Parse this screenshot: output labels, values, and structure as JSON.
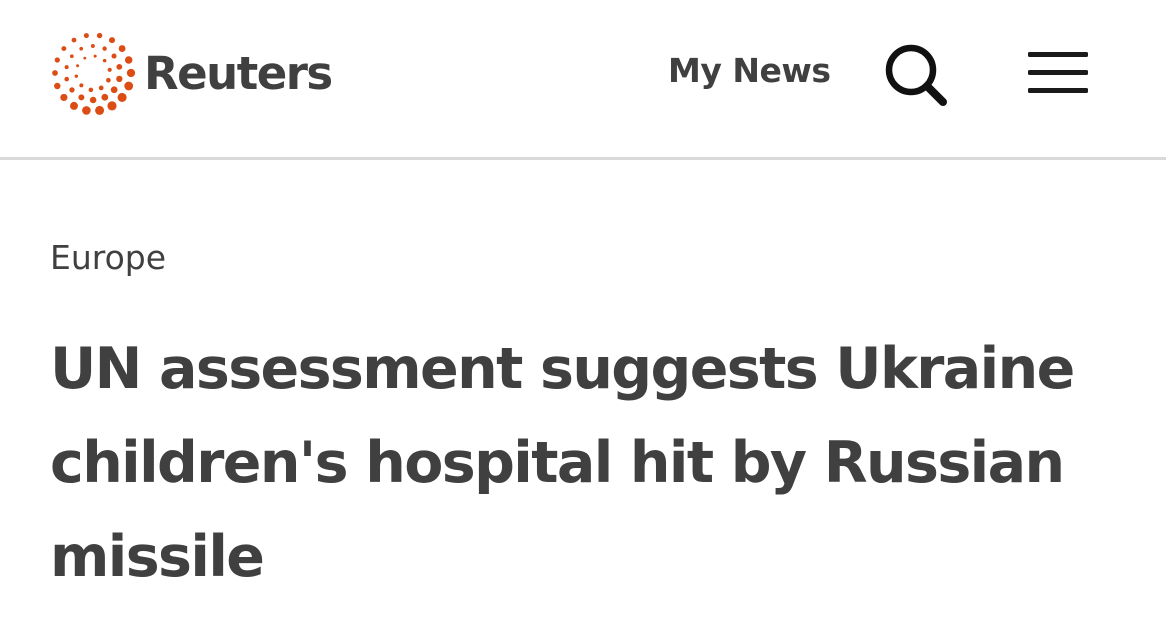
{
  "header": {
    "logo": {
      "icon": "reuters-dotted-ring-logo",
      "wordmark": "Reuters",
      "dot_color": "#dc4d16"
    },
    "my_news_label": "My News",
    "search_icon": "search-icon",
    "menu_icon": "hamburger-menu-icon"
  },
  "article": {
    "section": "Europe",
    "headline": "UN assessment suggests Ukraine children's hospital hit by Russian missile"
  },
  "colors": {
    "text": "#404040",
    "divider": "#d9d9d9",
    "brand_orange": "#dc4d16",
    "background": "#ffffff"
  }
}
